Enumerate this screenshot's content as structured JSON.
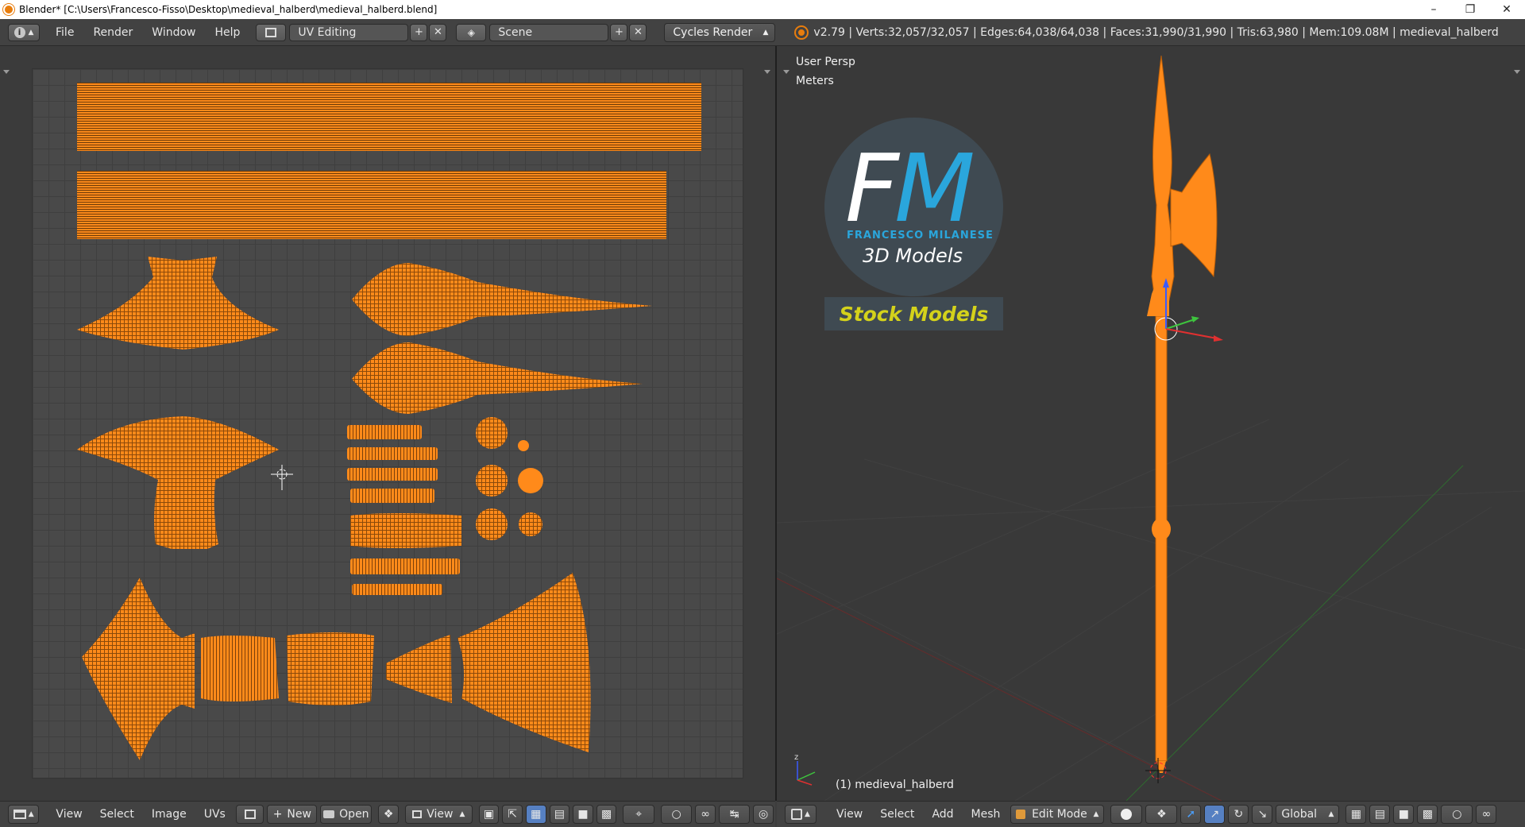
{
  "window": {
    "title": "Blender* [C:\\Users\\Francesco-Fisso\\Desktop\\medieval_halberd\\medieval_halberd.blend]",
    "minimize_icon": "minimize-icon",
    "restore_icon": "restore-icon",
    "close_icon": "close-icon"
  },
  "info_header": {
    "menus": [
      "File",
      "Render",
      "Window",
      "Help"
    ],
    "screen_layout": "UV Editing",
    "scene": "Scene",
    "render_engine": "Cycles Render",
    "stats": "v2.79 | Verts:32,057/32,057 | Edges:64,038/64,038 | Faces:31,990/31,990 | Tris:63,980 | Mem:109.08M | medieval_halberd"
  },
  "uv_editor": {
    "header": {
      "menus": [
        "View",
        "Select",
        "Image",
        "UVs"
      ],
      "new_label": "New",
      "open_label": "Open",
      "view_label": "View"
    }
  },
  "viewport": {
    "perspective": "User Persp",
    "units": "Meters",
    "object_label": "(1) medieval_halberd",
    "header": {
      "menus": [
        "View",
        "Select",
        "Add",
        "Mesh"
      ],
      "mode": "Edit Mode",
      "orientation": "Global"
    }
  },
  "logo": {
    "initial_f": "F",
    "initial_m": "M",
    "name": "FRANCESCO MILANESE",
    "subtitle": "3D Models",
    "stock": "Stock Models"
  },
  "colors": {
    "mesh_orange": "#ff8a1a",
    "accent_blue": "#2aa6dc",
    "stock_yellow": "#d4d21b"
  }
}
